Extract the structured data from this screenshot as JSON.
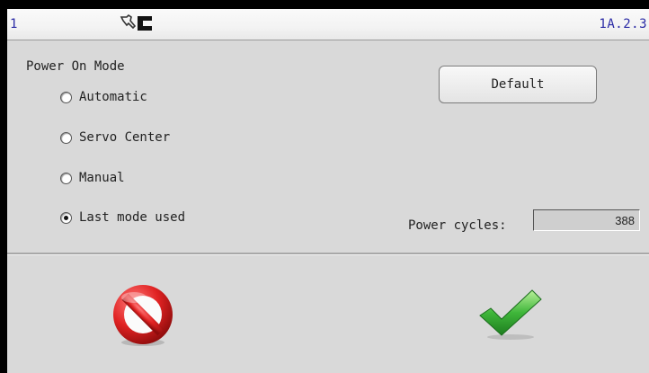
{
  "status_bar": {
    "left_text": "1",
    "version": "1A.2.3",
    "icons": [
      "hand-pointer-icon",
      "machine-status-icon"
    ]
  },
  "power_on_mode": {
    "label": "Power On Mode",
    "options": [
      {
        "label": "Automatic",
        "checked": false
      },
      {
        "label": "Servo Center",
        "checked": false
      },
      {
        "label": "Manual",
        "checked": false
      },
      {
        "label": "Last mode used",
        "checked": true
      }
    ]
  },
  "default_button": {
    "label": "Default"
  },
  "power_cycles": {
    "label": "Power cycles:",
    "value": "388"
  },
  "actions": {
    "cancel_icon": "no-entry-icon",
    "confirm_icon": "checkmark-icon",
    "cancel_color": "#d42020",
    "confirm_color": "#2e9a2e"
  }
}
